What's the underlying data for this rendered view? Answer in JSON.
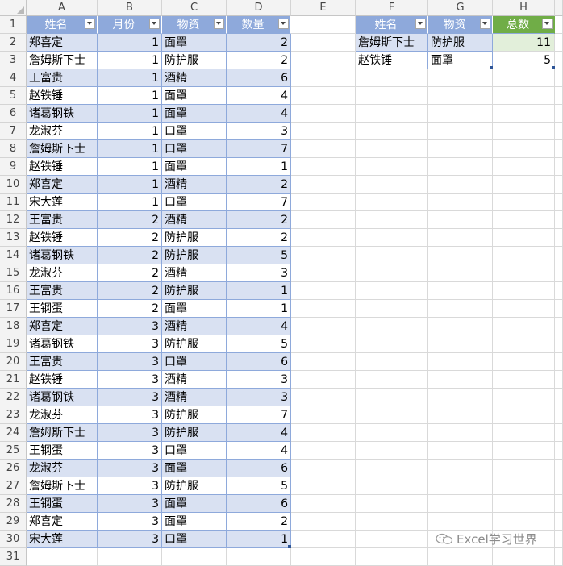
{
  "columns": [
    "A",
    "B",
    "C",
    "D",
    "E",
    "F",
    "G",
    "H"
  ],
  "row_numbers": [
    "1",
    "2",
    "3",
    "4",
    "5",
    "6",
    "7",
    "8",
    "9",
    "10",
    "11",
    "12",
    "13",
    "14",
    "15",
    "16",
    "17",
    "18",
    "19",
    "20",
    "21",
    "22",
    "23",
    "24",
    "25",
    "26",
    "27",
    "28",
    "29",
    "30",
    "31"
  ],
  "table1": {
    "headers": [
      "姓名",
      "月份",
      "物资",
      "数量"
    ],
    "rows": [
      [
        "郑喜定",
        "1",
        "面罩",
        "2"
      ],
      [
        "詹姆斯下士",
        "1",
        "防护服",
        "2"
      ],
      [
        "王富贵",
        "1",
        "酒精",
        "6"
      ],
      [
        "赵铁锤",
        "1",
        "面罩",
        "4"
      ],
      [
        "诸葛钢铁",
        "1",
        "面罩",
        "4"
      ],
      [
        "龙淑芬",
        "1",
        "口罩",
        "3"
      ],
      [
        "詹姆斯下士",
        "1",
        "口罩",
        "7"
      ],
      [
        "赵铁锤",
        "1",
        "面罩",
        "1"
      ],
      [
        "郑喜定",
        "1",
        "酒精",
        "2"
      ],
      [
        "宋大莲",
        "1",
        "口罩",
        "7"
      ],
      [
        "王富贵",
        "2",
        "酒精",
        "2"
      ],
      [
        "赵铁锤",
        "2",
        "防护服",
        "2"
      ],
      [
        "诸葛钢铁",
        "2",
        "防护服",
        "5"
      ],
      [
        "龙淑芬",
        "2",
        "酒精",
        "3"
      ],
      [
        "王富贵",
        "2",
        "防护服",
        "1"
      ],
      [
        "王钢蛋",
        "2",
        "面罩",
        "1"
      ],
      [
        "郑喜定",
        "3",
        "酒精",
        "4"
      ],
      [
        "诸葛钢铁",
        "3",
        "防护服",
        "5"
      ],
      [
        "王富贵",
        "3",
        "口罩",
        "6"
      ],
      [
        "赵铁锤",
        "3",
        "酒精",
        "3"
      ],
      [
        "诸葛钢铁",
        "3",
        "酒精",
        "3"
      ],
      [
        "龙淑芬",
        "3",
        "防护服",
        "7"
      ],
      [
        "詹姆斯下士",
        "3",
        "防护服",
        "4"
      ],
      [
        "王钢蛋",
        "3",
        "口罩",
        "4"
      ],
      [
        "龙淑芬",
        "3",
        "面罩",
        "6"
      ],
      [
        "詹姆斯下士",
        "3",
        "防护服",
        "5"
      ],
      [
        "王钢蛋",
        "3",
        "面罩",
        "6"
      ],
      [
        "郑喜定",
        "3",
        "面罩",
        "2"
      ],
      [
        "宋大莲",
        "3",
        "口罩",
        "1"
      ]
    ]
  },
  "table2": {
    "headers": [
      "姓名",
      "物资"
    ],
    "rows": [
      [
        "詹姆斯下士",
        "防护服"
      ],
      [
        "赵铁锤",
        "面罩"
      ]
    ]
  },
  "result": {
    "header": "总数",
    "values": [
      "11",
      "5"
    ],
    "header_color": "#70ad47"
  },
  "colors": {
    "table_header": "#8ea9db",
    "band": "#d9e1f2",
    "border": "#8ea9db"
  },
  "watermark": "Excel学习世界"
}
